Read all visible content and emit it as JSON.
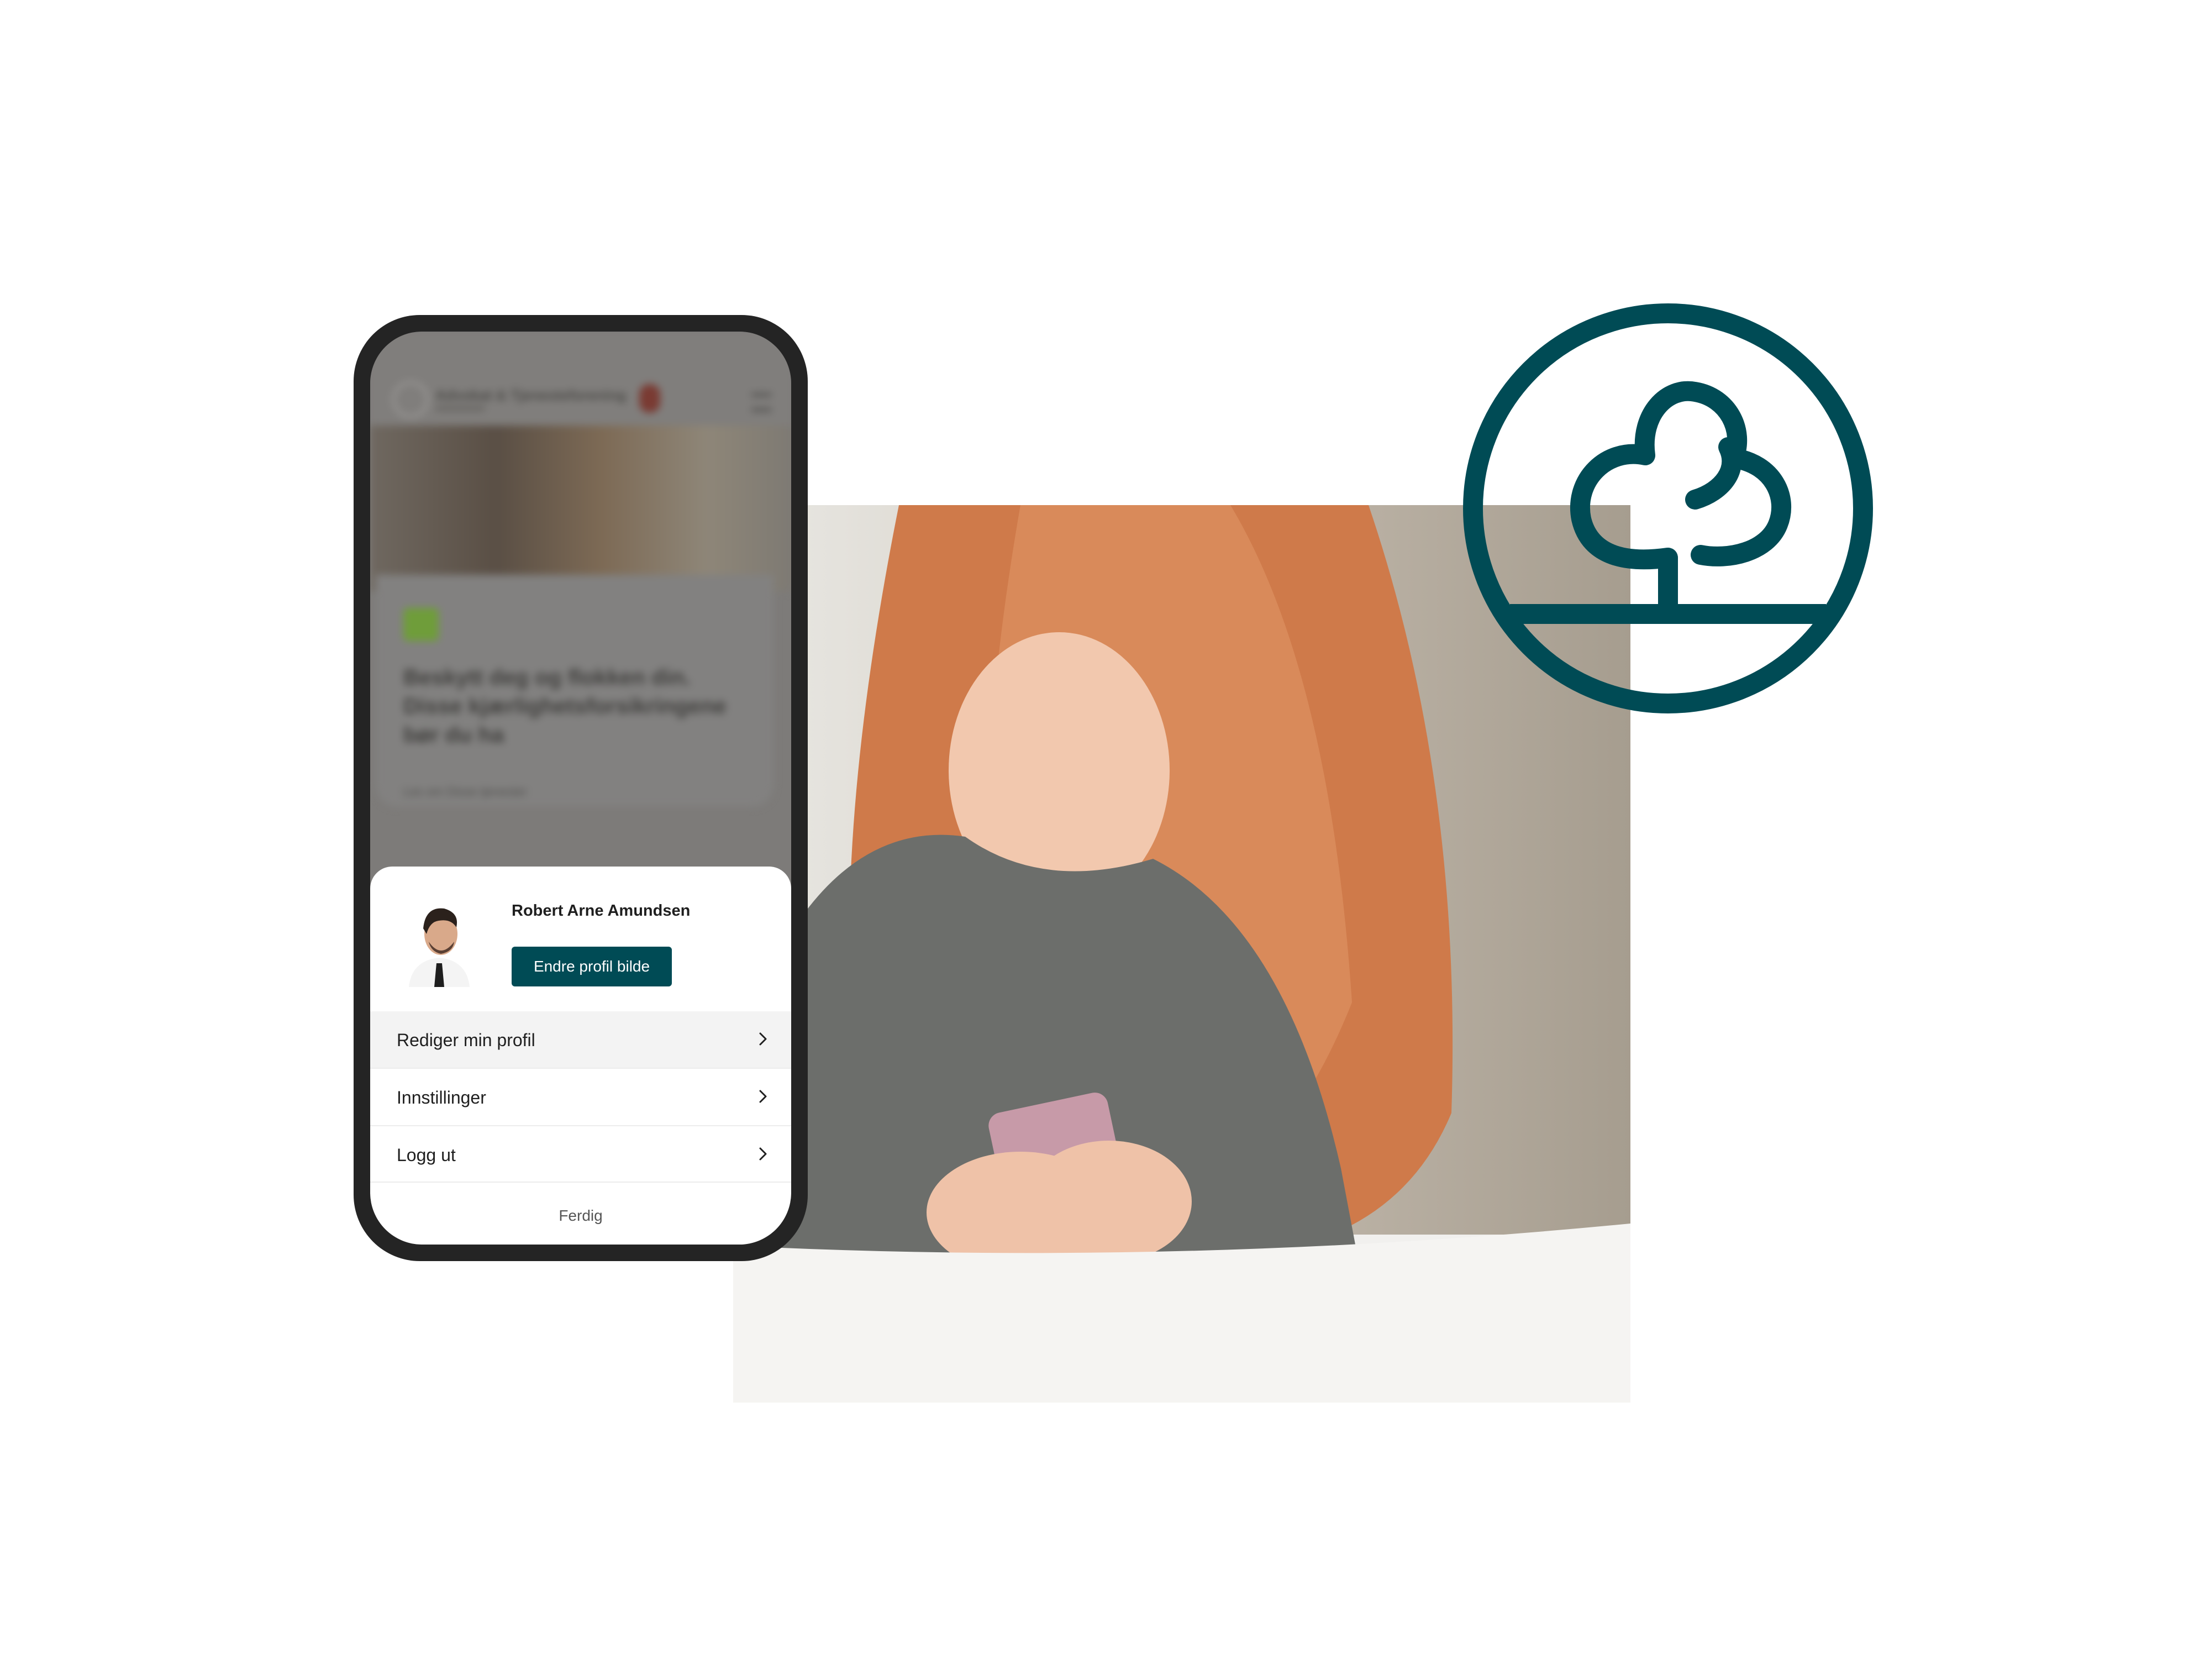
{
  "colors": {
    "brand_teal": "#004b55",
    "logo_stroke": "#004b55",
    "phone_frame": "#242424",
    "sheet_bg": "#ffffff"
  },
  "illustration": {
    "logo_icon": "tree-in-circle-icon",
    "photo": "woman-with-red-hair-using-phone"
  },
  "phone": {
    "background": {
      "brand": "Advokat & Tjenesteforening",
      "hero_icon": "heart-icon",
      "headline": "Beskytt deg og flokken din. Disse kjærlighetsforsikringene bør du ha",
      "link": "Les om Disse tjenester"
    },
    "profile": {
      "name": "Robert Arne Amundsen",
      "change_photo_button": "Endre profil bilde"
    },
    "menu": {
      "items": [
        {
          "label": "Rediger min profil",
          "icon": "chevron-right-icon"
        },
        {
          "label": "Innstillinger",
          "icon": "chevron-right-icon"
        },
        {
          "label": "Logg ut",
          "icon": "chevron-right-icon"
        }
      ]
    },
    "done_label": "Ferdig"
  }
}
